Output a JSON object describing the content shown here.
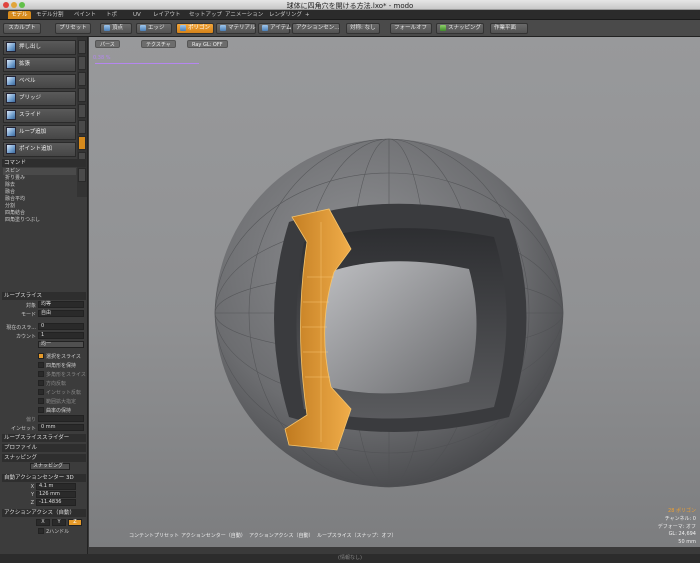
{
  "window": {
    "title": "球体に四角穴を開ける方法.lxo* - modo"
  },
  "tabs": [
    "モデル",
    "モデル分割",
    "ペイント",
    "トポ",
    "UV",
    "レイアウト",
    "セットアップ",
    "アニメーション",
    "レンダリング",
    "+"
  ],
  "toolbar": {
    "sculpt": "スカルプト",
    "presets": "プリセット",
    "vertex": "頂点",
    "edge": "エッジ",
    "polygon": "ポリゴン",
    "material": "マテリアル",
    "item": "アイテム",
    "action_center": "アクションセン...",
    "symmetry": "対称: なし",
    "falloff": "フォールオフ",
    "snapping": "スナッピング",
    "work_plane": "作業平面"
  },
  "tools": [
    "押し出し",
    "拡張",
    "ベベル",
    "ブリッジ",
    "スライド",
    "ループ追加",
    "ポイント追加"
  ],
  "command_section": "コマンド",
  "commands": [
    "スピン",
    "折り畳み",
    "除去",
    "融合",
    "融合平均",
    "分割",
    "四角結合",
    "四角塗りつぶし"
  ],
  "loop_slice": {
    "header": "ループスライス",
    "target_label": "対象",
    "target_value": "均等",
    "mode_label": "モード",
    "mode_value": "自由",
    "count_slider_label": "現在のスラ...",
    "count_slider_value": "0",
    "count_label": "カウント",
    "count_value": "1",
    "average_btn": "均一",
    "options": [
      {
        "label": "選択をスライス",
        "on": true,
        "dim": false
      },
      {
        "label": "四角形を保持",
        "on": false,
        "dim": false
      },
      {
        "label": "多角形をスライス",
        "on": false,
        "dim": true
      },
      {
        "label": "方向反転",
        "on": false,
        "dim": true
      },
      {
        "label": "インセット反転",
        "on": false,
        "dim": true
      },
      {
        "label": "範囲拡大指定",
        "on": false,
        "dim": true
      },
      {
        "label": "曲率の保持",
        "on": false,
        "dim": false
      }
    ],
    "bias_label": "偏り",
    "bias_value": "",
    "inset_label": "インセット",
    "inset_value": "0 mm"
  },
  "loop_slice_slider": "ループスライススライダー",
  "profile": "プロファイル",
  "snapping_section": "スナッピング",
  "snapping_btn": "スナッピング",
  "auto_action_center": "自動アクションセンター 3D",
  "coords": {
    "x": "4.1 m",
    "y": "126 mm",
    "z": "-11.4836"
  },
  "action_axis": "アクションアクシス（自動）",
  "axis_buttons": [
    "X",
    "Y",
    "Z"
  ],
  "two_handles": "2ハンドル",
  "viewport": {
    "tabs": [
      "パース",
      "テクスチャ",
      "Ray GL: OFF"
    ],
    "zoom_readout": "0.38 %",
    "polys": "28 ポリゴン",
    "channel": "チャンネル: 0",
    "deformer": "デフォーマ: オフ",
    "gl": "GL: 24,694",
    "distance": "50 mm"
  },
  "status": [
    "コンテントプリセット",
    "アクションセンター（自動）",
    "アクションアクシス（自動）",
    "ループスライス（スナップ：オフ）"
  ],
  "bottom": "(情報なし)",
  "colors": {
    "accent": "#d68a1c",
    "selection": "#e8a23c"
  }
}
